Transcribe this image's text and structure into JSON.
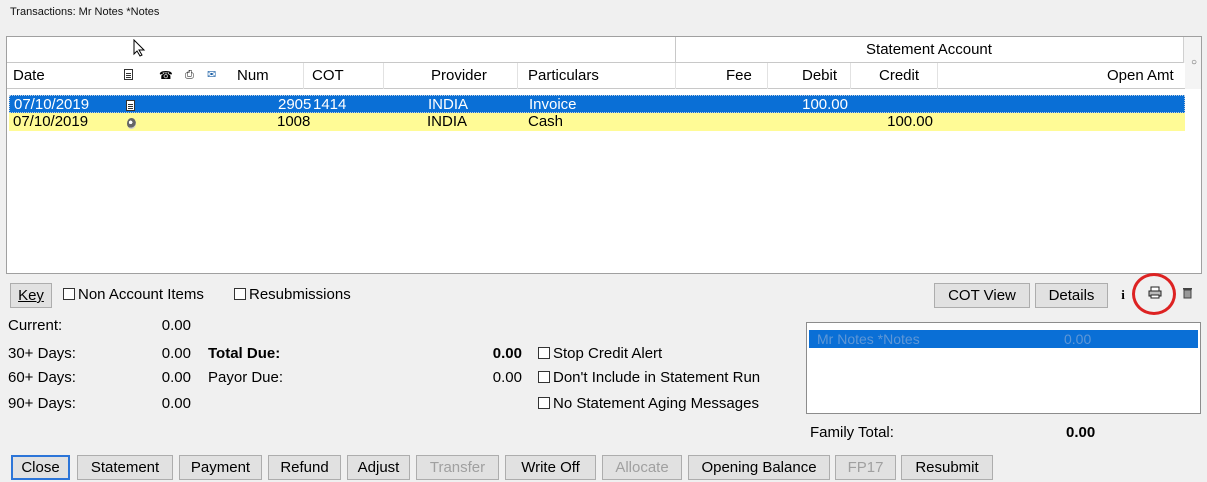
{
  "window": {
    "title": "Transactions: Mr Notes *Notes"
  },
  "grid": {
    "group_header": "Statement Account",
    "columns": [
      "Date",
      "Num",
      "COT",
      "Provider",
      "Particulars",
      "Fee",
      "Debit",
      "Credit",
      "Open Amt"
    ],
    "rows": [
      {
        "date": "07/10/2019",
        "icon": "document-icon",
        "num": "2905",
        "cot": "1414",
        "provider": "INDIA",
        "particulars": "Invoice",
        "fee": "",
        "debit": "100.00",
        "credit": "",
        "open": "",
        "selected": true
      },
      {
        "date": "07/10/2019",
        "icon": "coin-icon",
        "num": "1008",
        "cot": "",
        "provider": "INDIA",
        "particulars": "Cash",
        "fee": "",
        "debit": "",
        "credit": "100.00",
        "open": "",
        "highlight": "#fffb96"
      }
    ]
  },
  "toolbar": {
    "key": "Key",
    "non_account_items": "Non Account Items",
    "resubmissions": "Resubmissions",
    "cot_view": "COT View",
    "details": "Details",
    "info_glyph": "i"
  },
  "aging": {
    "current_label": "Current:",
    "current": "0.00",
    "d30_label": "30+ Days:",
    "d30": "0.00",
    "d60_label": "60+ Days:",
    "d60": "0.00",
    "d90_label": "90+ Days:",
    "d90": "0.00"
  },
  "totals": {
    "total_due_label": "Total Due:",
    "total_due": "0.00",
    "payor_due_label": "Payor Due:",
    "payor_due": "0.00"
  },
  "options": {
    "stop_credit_alert": "Stop Credit Alert",
    "dont_include": "Don't Include in Statement Run",
    "no_aging_msgs": "No Statement Aging Messages"
  },
  "family": {
    "rows": [
      {
        "name": "Mr Notes *Notes",
        "amount": "0.00"
      }
    ],
    "total_label": "Family Total:",
    "total": "0.00"
  },
  "buttons": {
    "close": "Close",
    "statement": "Statement",
    "payment": "Payment",
    "refund": "Refund",
    "adjust": "Adjust",
    "transfer": "Transfer",
    "write_off": "Write Off",
    "allocate": "Allocate",
    "opening_balance": "Opening Balance",
    "fp17": "FP17",
    "resubmit": "Resubmit"
  },
  "colors": {
    "selection": "#0a6fd6",
    "highlight_row": "#fffb96",
    "annotation_ring": "#dd2222"
  }
}
